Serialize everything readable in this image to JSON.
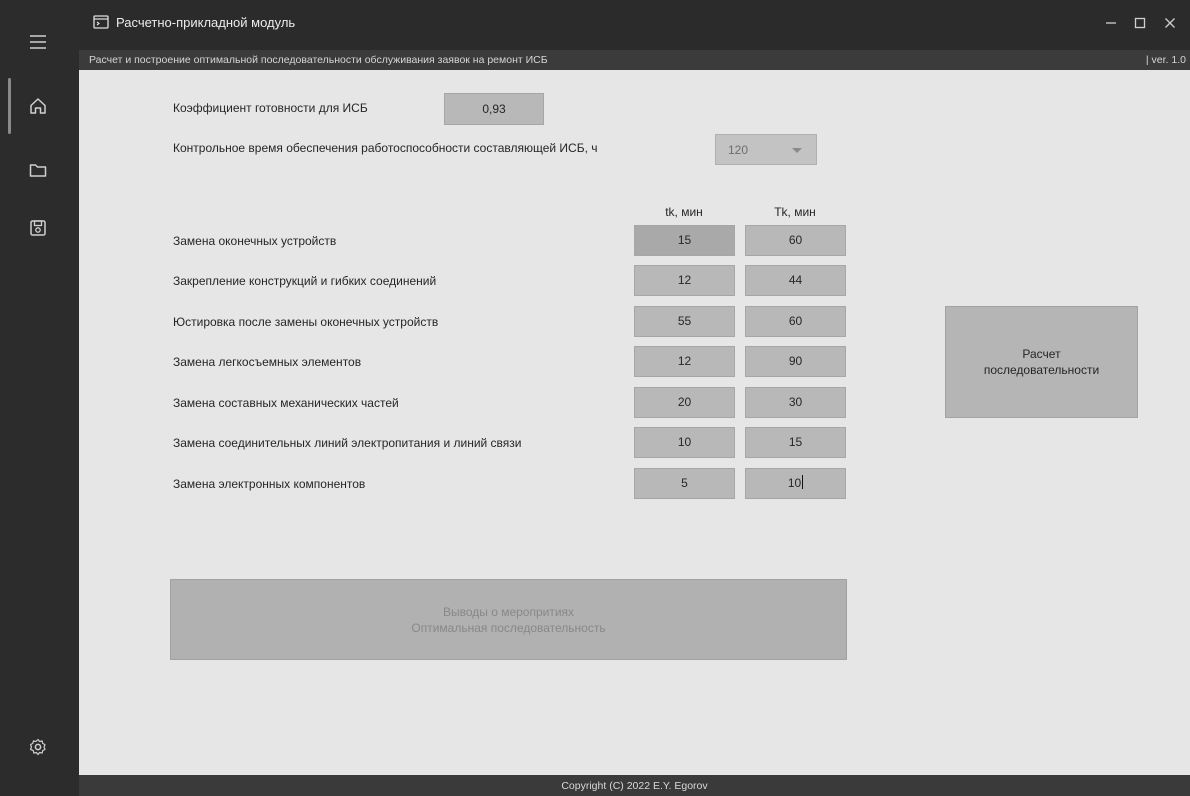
{
  "window": {
    "title": "Расчетно-прикладной модуль",
    "minimize_icon": "minimize-icon",
    "maximize_icon": "maximize-icon",
    "close_icon": "close-icon"
  },
  "subheader": {
    "description": "Расчет и построение оптимальной последовательности обслуживания заявок на ремонт ИСБ",
    "version": "| ver. 1.0"
  },
  "sidebar": {
    "icons": [
      "menu-icon",
      "home-icon",
      "folder-icon",
      "save-icon",
      "settings-icon"
    ]
  },
  "form": {
    "readiness_label": "Коэффициент готовности для ИСБ",
    "readiness_value": "0,93",
    "control_time_label": "Контрольное время обеспечения работоспособности составляющей ИСБ, ч",
    "control_time_value": "120",
    "col_tk": "tk, мин",
    "col_Tk": "Tk, мин",
    "rows": [
      {
        "label": "Замена оконечных устройств",
        "tk": "15",
        "Tk": "60"
      },
      {
        "label": "Закрепление конструкций и гибких соединений",
        "tk": "12",
        "Tk": "44"
      },
      {
        "label": "Юстировка после замены оконечных устройств",
        "tk": "55",
        "Tk": "60"
      },
      {
        "label": "Замена легкосъемных элементов",
        "tk": "12",
        "Tk": "90"
      },
      {
        "label": "Замена составных механических частей",
        "tk": "20",
        "Tk": "30"
      },
      {
        "label": "Замена соединительных линий электропитания и линий связи",
        "tk": "10",
        "Tk": "15"
      },
      {
        "label": "Замена электронных компонентов",
        "tk": "5",
        "Tk": "10"
      }
    ]
  },
  "buttons": {
    "calc_line1": "Расчет",
    "calc_line2": "последовательности",
    "output_line1": "Выводы о меропритиях",
    "output_line2": "Оптимальная последовательность"
  },
  "footer": {
    "copyright": "Copyright (C) 2022  E.Y. Egorov"
  }
}
